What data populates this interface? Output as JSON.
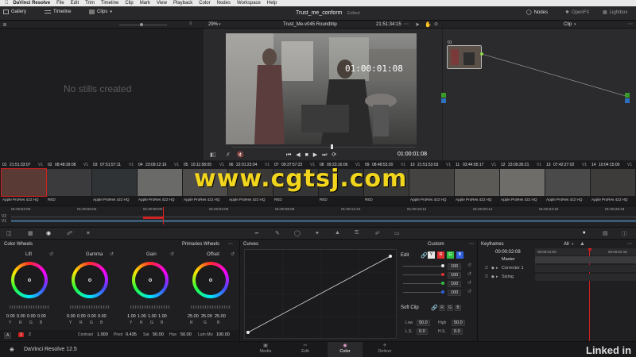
{
  "menubar": {
    "app_name": "DaVinci Resolve",
    "items": [
      "File",
      "Edit",
      "Trim",
      "Timeline",
      "Clip",
      "Mark",
      "View",
      "Playback",
      "Color",
      "Nodes",
      "Workspace",
      "Help"
    ]
  },
  "toolbar": {
    "gallery": "Gallery",
    "timeline": "Timeline",
    "clips": "Clips",
    "project_name": "Trust_me_conform",
    "project_status": "Edited",
    "nodes": "Nodes",
    "openfx": "OpenFX",
    "lightbox": "Lightbox"
  },
  "viewer_header": {
    "zoom": "29%",
    "timeline_name": "Trust_Me-v045 Roundtrip",
    "timecode": "21:51:34:15",
    "mode": "Clip"
  },
  "gallery": {
    "empty_text": "No stills created"
  },
  "viewer": {
    "overlay_timecode": "01:00:01:08",
    "bottom_timecode": "01:00:01:08"
  },
  "nodes": {
    "node_label": "01"
  },
  "clips": [
    {
      "num": "01",
      "tc": "21:51:33:07",
      "track": "V1",
      "codec": "Apple ProRes 422 HQ",
      "color": "#5a3a35"
    },
    {
      "num": "02",
      "tc": "08:48:39:08",
      "track": "V1",
      "codec": "RED",
      "color": "#3b3b3e"
    },
    {
      "num": "03",
      "tc": "07:51:57:11",
      "track": "V1",
      "codec": "Apple ProRes 422 HQ",
      "color": "#2f3336"
    },
    {
      "num": "04",
      "tc": "23:09:12:16",
      "track": "V1",
      "codec": "Apple ProRes 422 HQ",
      "color": "#6a6a68"
    },
    {
      "num": "05",
      "tc": "10:11:58:05",
      "track": "V1",
      "codec": "Apple ProRes 422 HQ",
      "color": "#4d4c4a"
    },
    {
      "num": "06",
      "tc": "22:01:23:04",
      "track": "V1",
      "codec": "Apple ProRes 422 HQ",
      "color": "#3a3935"
    },
    {
      "num": "07",
      "tc": "09:37:57:22",
      "track": "V1",
      "codec": "RED",
      "color": "#353536"
    },
    {
      "num": "08",
      "tc": "09:23:16:06",
      "track": "V1",
      "codec": "RED",
      "color": "#2e2f31"
    },
    {
      "num": "09",
      "tc": "08:48:53:20",
      "track": "V1",
      "codec": "RED",
      "color": "#383837"
    },
    {
      "num": "10",
      "tc": "21:51:53:03",
      "track": "V1",
      "codec": "Apple ProRes 422 HQ",
      "color": "#444342"
    },
    {
      "num": "11",
      "tc": "03:44:05:17",
      "track": "V1",
      "codec": "Apple ProRes 422 HQ",
      "color": "#5b5a57"
    },
    {
      "num": "12",
      "tc": "23:09:36:21",
      "track": "V1",
      "codec": "Apple ProRes 422 HQ",
      "color": "#6e6d6a"
    },
    {
      "num": "13",
      "tc": "07:42:27:02",
      "track": "V1",
      "codec": "Apple ProRes 422 HQ",
      "color": "#4a4a4b"
    },
    {
      "num": "14",
      "tc": "10:04:15:00",
      "track": "V1",
      "codec": "Apple ProRes 422 HQ",
      "color": "#3d3c3a"
    }
  ],
  "watermark": "www.cgtsj.com",
  "mini_timeline": {
    "ticks": [
      "01:00:52:00",
      "01:00:56:02",
      "01:00:00:00",
      "01:00:04:06",
      "01:00:08:08",
      "01:00:12:10",
      "01:00:16:12",
      "01:00:20:14",
      "01:00:24:16",
      "01:00:28:18"
    ],
    "tracks": [
      "V2",
      "V1"
    ]
  },
  "color_wheels": {
    "title": "Color Wheels",
    "mode": "Primaries Wheels",
    "wheels": [
      {
        "name": "Lift",
        "values": [
          "0.00",
          "0.00",
          "0.00",
          "0.00"
        ]
      },
      {
        "name": "Gamma",
        "values": [
          "0.00",
          "0.00",
          "0.00",
          "0.00"
        ]
      },
      {
        "name": "Gain",
        "values": [
          "1.00",
          "1.00",
          "1.00",
          "1.00"
        ]
      },
      {
        "name": "Offset",
        "values": [
          "25.00",
          "25.00",
          "25.00",
          ""
        ]
      }
    ],
    "channel_labels": [
      "Y",
      "R",
      "G",
      "B"
    ],
    "offset_labels": [
      "R",
      "G",
      "B"
    ],
    "params": {
      "contrast_label": "Contrast",
      "contrast": "1.000",
      "pivot_label": "Pivot",
      "pivot": "0.435",
      "sat_label": "Sat",
      "sat": "50.00",
      "hue_label": "Hue",
      "hue": "50.00",
      "lummix_label": "Lum Mix",
      "lummix": "100.00"
    },
    "page_a": "A",
    "page_1": "1",
    "page_2": "2"
  },
  "curves": {
    "title": "Curves",
    "edit_label": "Edit",
    "custom_label": "Custom",
    "channel_buttons": [
      "Y",
      "R",
      "G",
      "B"
    ],
    "channel_values": [
      "100",
      "100",
      "100",
      "100"
    ],
    "channel_colors": [
      "#e6e6e6",
      "#e03030",
      "#30c040",
      "#3060e0"
    ],
    "soft_clip_label": "Soft Clip",
    "soft_clip_buttons": [
      "R",
      "G",
      "B"
    ],
    "low_label": "Low",
    "low": "50.0",
    "high_label": "High",
    "high": "50.0",
    "ls_label": "L.S.",
    "ls": "0.0",
    "hs_label": "H.S.",
    "hs": "0.0"
  },
  "keyframes": {
    "title": "Keyframes",
    "filter": "All",
    "timecode": "00:00:02:08",
    "ruler_start": "00:00:01:00",
    "ruler_end": "00:00:02:15",
    "rows": [
      "Master",
      "Corrector 1",
      "Sizing"
    ]
  },
  "bottom": {
    "app_label": "DaVinci Resolve 12.5",
    "tabs": [
      {
        "label": "Media",
        "icon": "media-icon"
      },
      {
        "label": "Edit",
        "icon": "edit-icon"
      },
      {
        "label": "Color",
        "icon": "color-icon"
      },
      {
        "label": "Deliver",
        "icon": "deliver-icon"
      }
    ],
    "brand": "Linked in"
  }
}
